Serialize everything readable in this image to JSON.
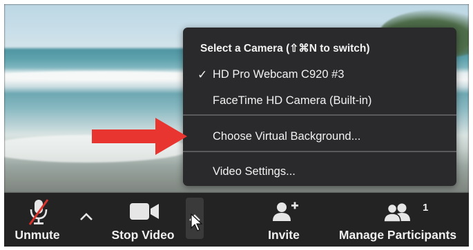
{
  "menu": {
    "heading": "Select a Camera (⇧⌘N to switch)",
    "items": [
      {
        "label": "HD Pro Webcam C920 #3",
        "checked": true
      },
      {
        "label": "FaceTime HD Camera (Built-in)",
        "checked": false
      },
      {
        "label": "Choose Virtual Background..."
      },
      {
        "label": "Video Settings..."
      }
    ],
    "check_glyph": "✓"
  },
  "toolbar": {
    "unmute_label": "Unmute",
    "unmute_icon": "microphone-muted-icon",
    "stop_video_label": "Stop Video",
    "stop_video_icon": "video-camera-icon",
    "invite_label": "Invite",
    "invite_icon": "add-person-icon",
    "participants_label": "Manage Participants",
    "participants_icon": "participants-icon",
    "participants_count": "1"
  },
  "colors": {
    "menu_bg": "#2a2a2c",
    "toolbar_bg": "#232323",
    "arrow": "#e8352f",
    "muted": "#d9342b"
  }
}
